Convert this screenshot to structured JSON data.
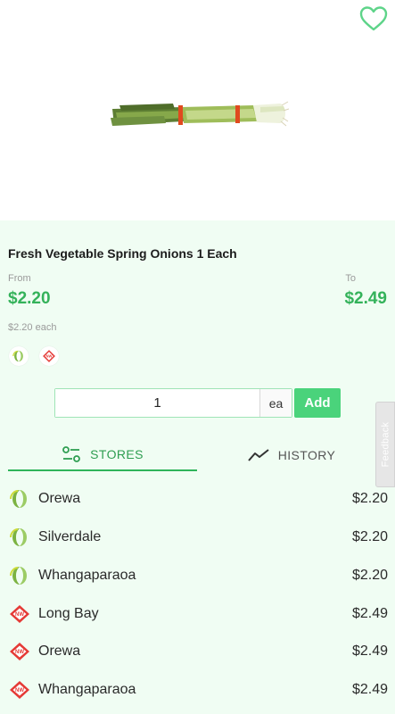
{
  "product": {
    "title": "Fresh Vegetable Spring Onions 1 Each",
    "from_label": "From",
    "from_price": "$2.20",
    "to_label": "To",
    "to_price": "$2.49",
    "unit_price": "$2.20 each"
  },
  "quantity": {
    "value": "1",
    "unit": "ea",
    "add_label": "Add"
  },
  "feedback_label": "Feedback",
  "tabs": [
    {
      "label": "STORES",
      "icon": "stores-filter-icon",
      "active": true
    },
    {
      "label": "HISTORY",
      "icon": "history-chart-icon",
      "active": false
    }
  ],
  "stores": [
    {
      "name": "Orewa",
      "price": "$2.20",
      "chain": "woolworths"
    },
    {
      "name": "Silverdale",
      "price": "$2.20",
      "chain": "woolworths"
    },
    {
      "name": "Whangaparaoa",
      "price": "$2.20",
      "chain": "woolworths"
    },
    {
      "name": "Long Bay",
      "price": "$2.49",
      "chain": "new-world"
    },
    {
      "name": "Orewa",
      "price": "$2.49",
      "chain": "new-world"
    },
    {
      "name": "Whangaparaoa",
      "price": "$2.49",
      "chain": "new-world"
    }
  ],
  "colors": {
    "accent": "#34b25a",
    "button": "#4ad37b",
    "background": "#f0fdf3"
  }
}
